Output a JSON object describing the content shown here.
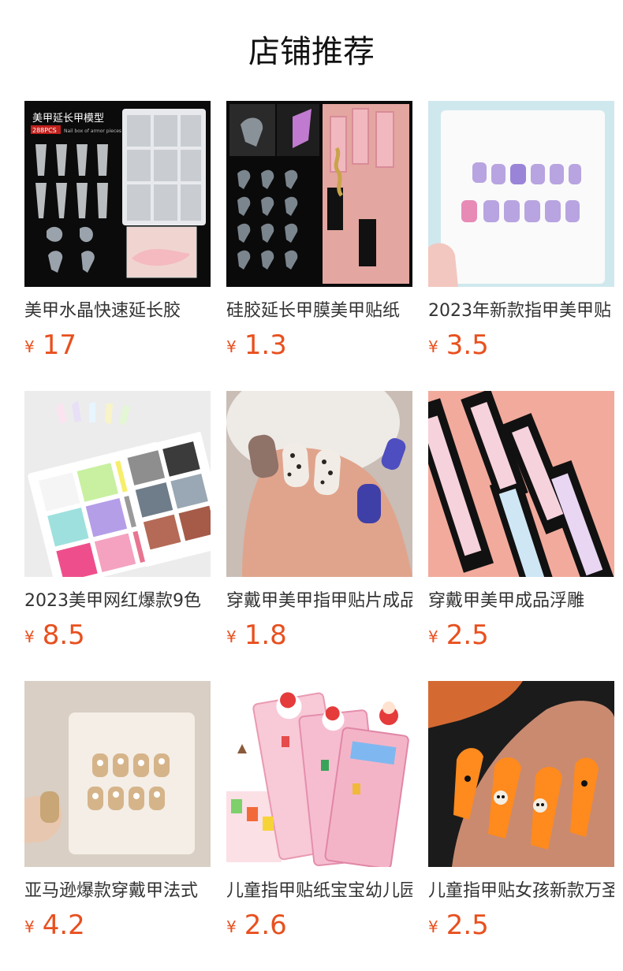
{
  "section_title": "店铺推荐",
  "currency": "¥",
  "products": [
    {
      "name": "美甲水晶快速延长胶",
      "price": "17",
      "image": "nail-extension-mold-box",
      "image_heading": "美甲延长甲模型",
      "image_badge": "288PCS",
      "image_caption": "Nail box of armor pieces"
    },
    {
      "name": "硅胶延长甲膜美甲贴纸",
      "price": "1.3",
      "image": "silicone-nail-form-photo"
    },
    {
      "name": "2023年新款指甲美甲贴",
      "price": "3.5",
      "image": "purple-checker-press-on-nails"
    },
    {
      "name": "2023美甲网红爆款9色",
      "price": "8.5",
      "image": "solid-color-palette"
    },
    {
      "name": "穿戴甲美甲指甲贴片成品",
      "price": "1.8",
      "image": "leopard-print-nails-hand"
    },
    {
      "name": "穿戴甲美甲成品浮雕",
      "price": "2.5",
      "image": "boxed-nail-sets"
    },
    {
      "name": "亚马逊爆款穿戴甲法式",
      "price": "4.2",
      "image": "gold-glitter-pearl-nails"
    },
    {
      "name": "儿童指甲贴纸宝宝幼儿园",
      "price": "2.6",
      "image": "kids-christmas-nail-stickers"
    },
    {
      "name": "儿童指甲贴女孩新款万圣节",
      "price": "2.5",
      "image": "orange-halloween-nails"
    }
  ],
  "colors": {
    "price": "#e8501f",
    "title": "#111111",
    "name": "#333333"
  }
}
